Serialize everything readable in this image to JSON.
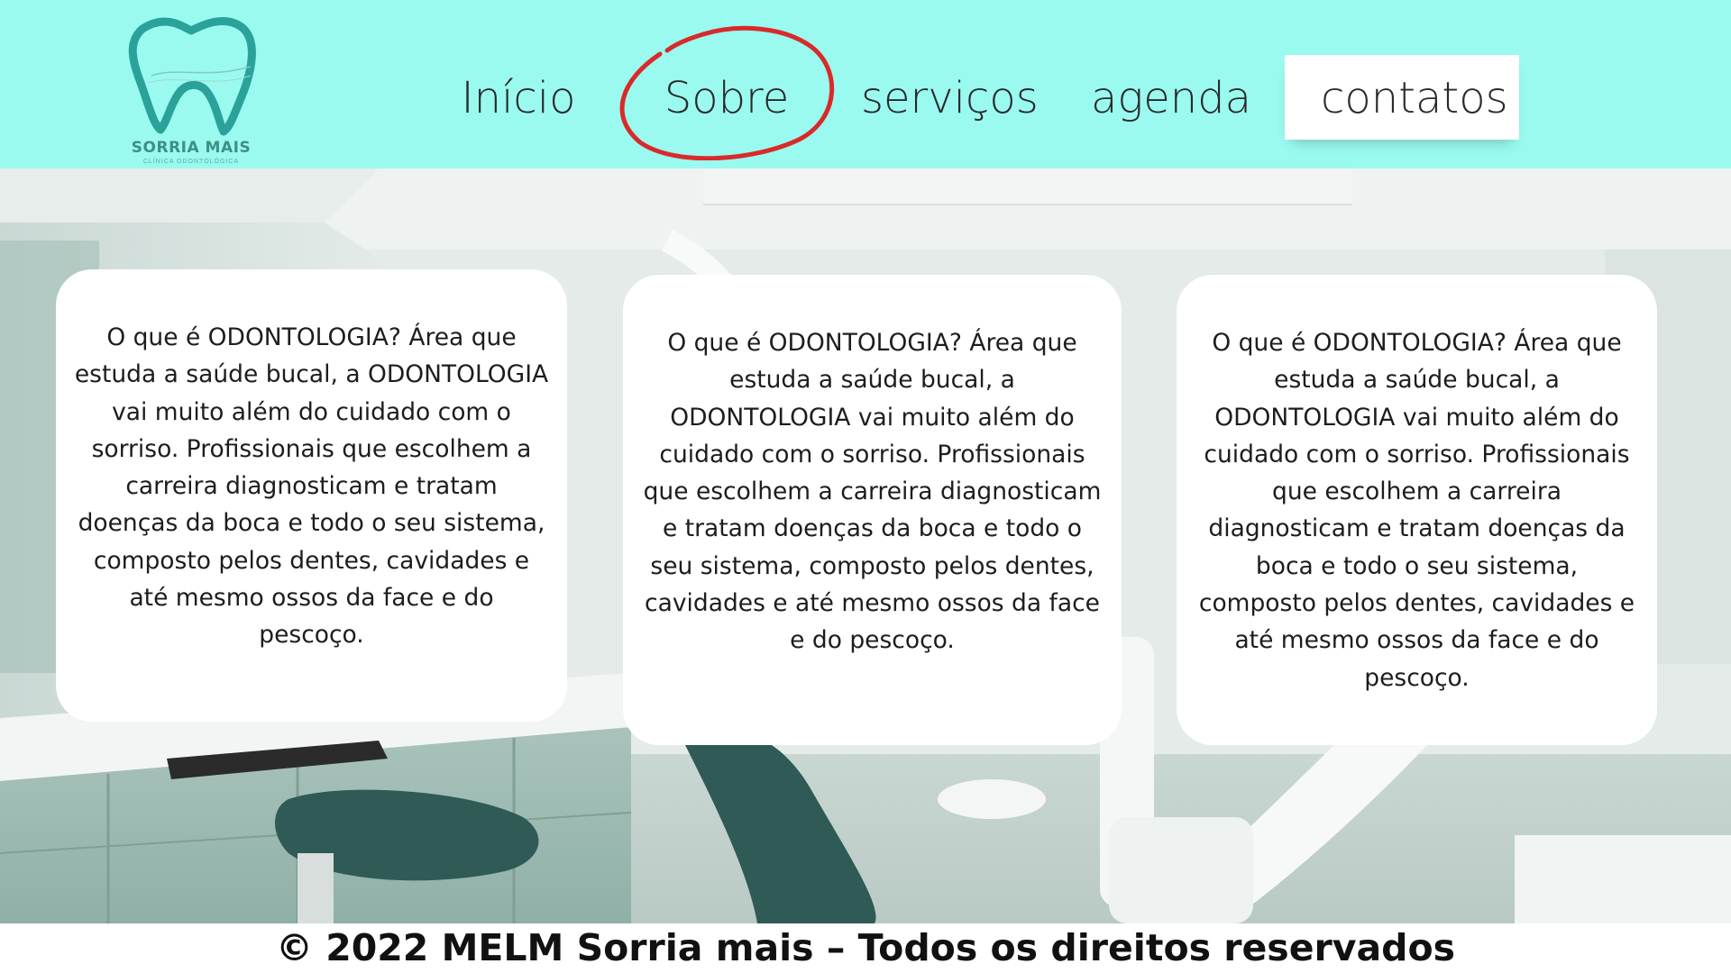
{
  "brand": {
    "name": "SORRIA MAIS",
    "subtitle": "CLÍNICA ODONTOLÓGICA"
  },
  "nav": {
    "items": [
      {
        "label": "Início"
      },
      {
        "label": "Sobre"
      },
      {
        "label": "serviços"
      },
      {
        "label": "agenda"
      },
      {
        "label": "contatos"
      }
    ]
  },
  "cards": [
    {
      "text": "O que é ODONTOLOGIA? Área que estuda a saúde bucal, a ODONTOLOGIA vai muito além do cuidado com o sorriso. Profissionais que escolhem a carreira diagnosticam e tratam doenças da boca e todo o seu sistema, composto pelos dentes, cavidades e até mesmo ossos da face e do pescoço."
    },
    {
      "text": "O que é ODONTOLOGIA? Área que estuda a saúde bucal, a ODONTOLOGIA vai muito além do cuidado com o sorriso. Profissionais que escolhem a carreira diagnosticam e tratam doenças da boca e todo o seu sistema, composto pelos dentes, cavidades e até mesmo ossos da face e do pescoço."
    },
    {
      "text": "O que é ODONTOLOGIA? Área que estuda a saúde bucal, a ODONTOLOGIA vai muito além do cuidado com o sorriso. Profissionais que escolhem a carreira diagnosticam e tratam doenças da boca e todo o seu sistema, composto pelos dentes, cavidades e até mesmo ossos da face e do pescoço."
    }
  ],
  "footer": {
    "text": "© 2022 MELM Sorria mais – Todos os direitos reservados"
  },
  "colors": {
    "header_bg": "#9afaf0",
    "logo": "#2aa29a",
    "annotation_circle": "#d92a2a",
    "chair": "#2f5a55"
  },
  "icons": {
    "logo": "tooth-logo-icon"
  }
}
